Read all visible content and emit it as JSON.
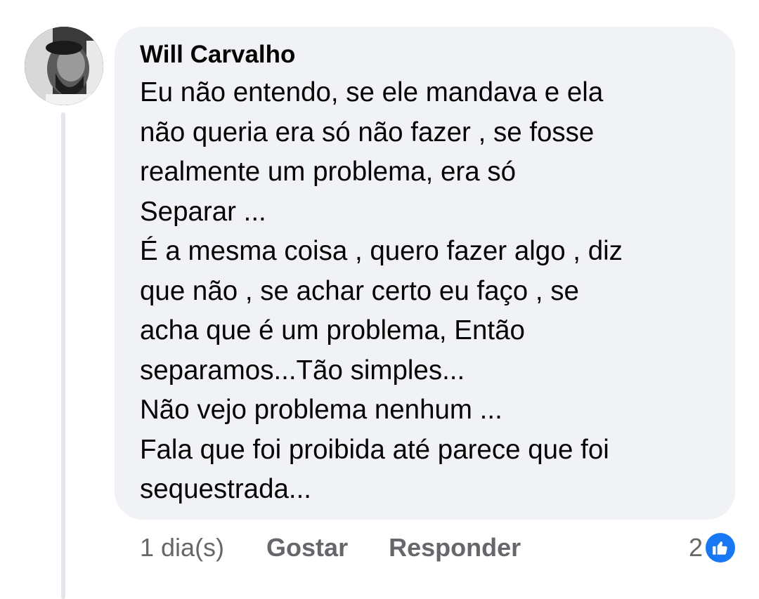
{
  "comment": {
    "author": "Will Carvalho",
    "avatar_icon": "profile-photo",
    "lines": [
      "Eu não entendo, se ele mandava e ela",
      "não queria era só não fazer , se fosse",
      "realmente um problema, era só",
      "Separar ...",
      "É a mesma coisa , quero fazer algo , diz",
      "que não , se achar certo eu faço , se",
      "acha que é um problema, Então",
      "separamos...Tão simples...",
      "Não vejo problema nenhum ...",
      "Fala que foi proibida até parece que foi",
      "sequestrada..."
    ],
    "time": "1 dia(s)",
    "like_label": "Gostar",
    "reply_label": "Responder",
    "reaction_count": "2",
    "reaction_icon": "like-thumb-icon"
  },
  "colors": {
    "bubble": "#f0f2f5",
    "text": "#050505",
    "secondary_text": "#65676b",
    "like_blue": "#1877f2",
    "thread_line": "#e4e6eb"
  }
}
